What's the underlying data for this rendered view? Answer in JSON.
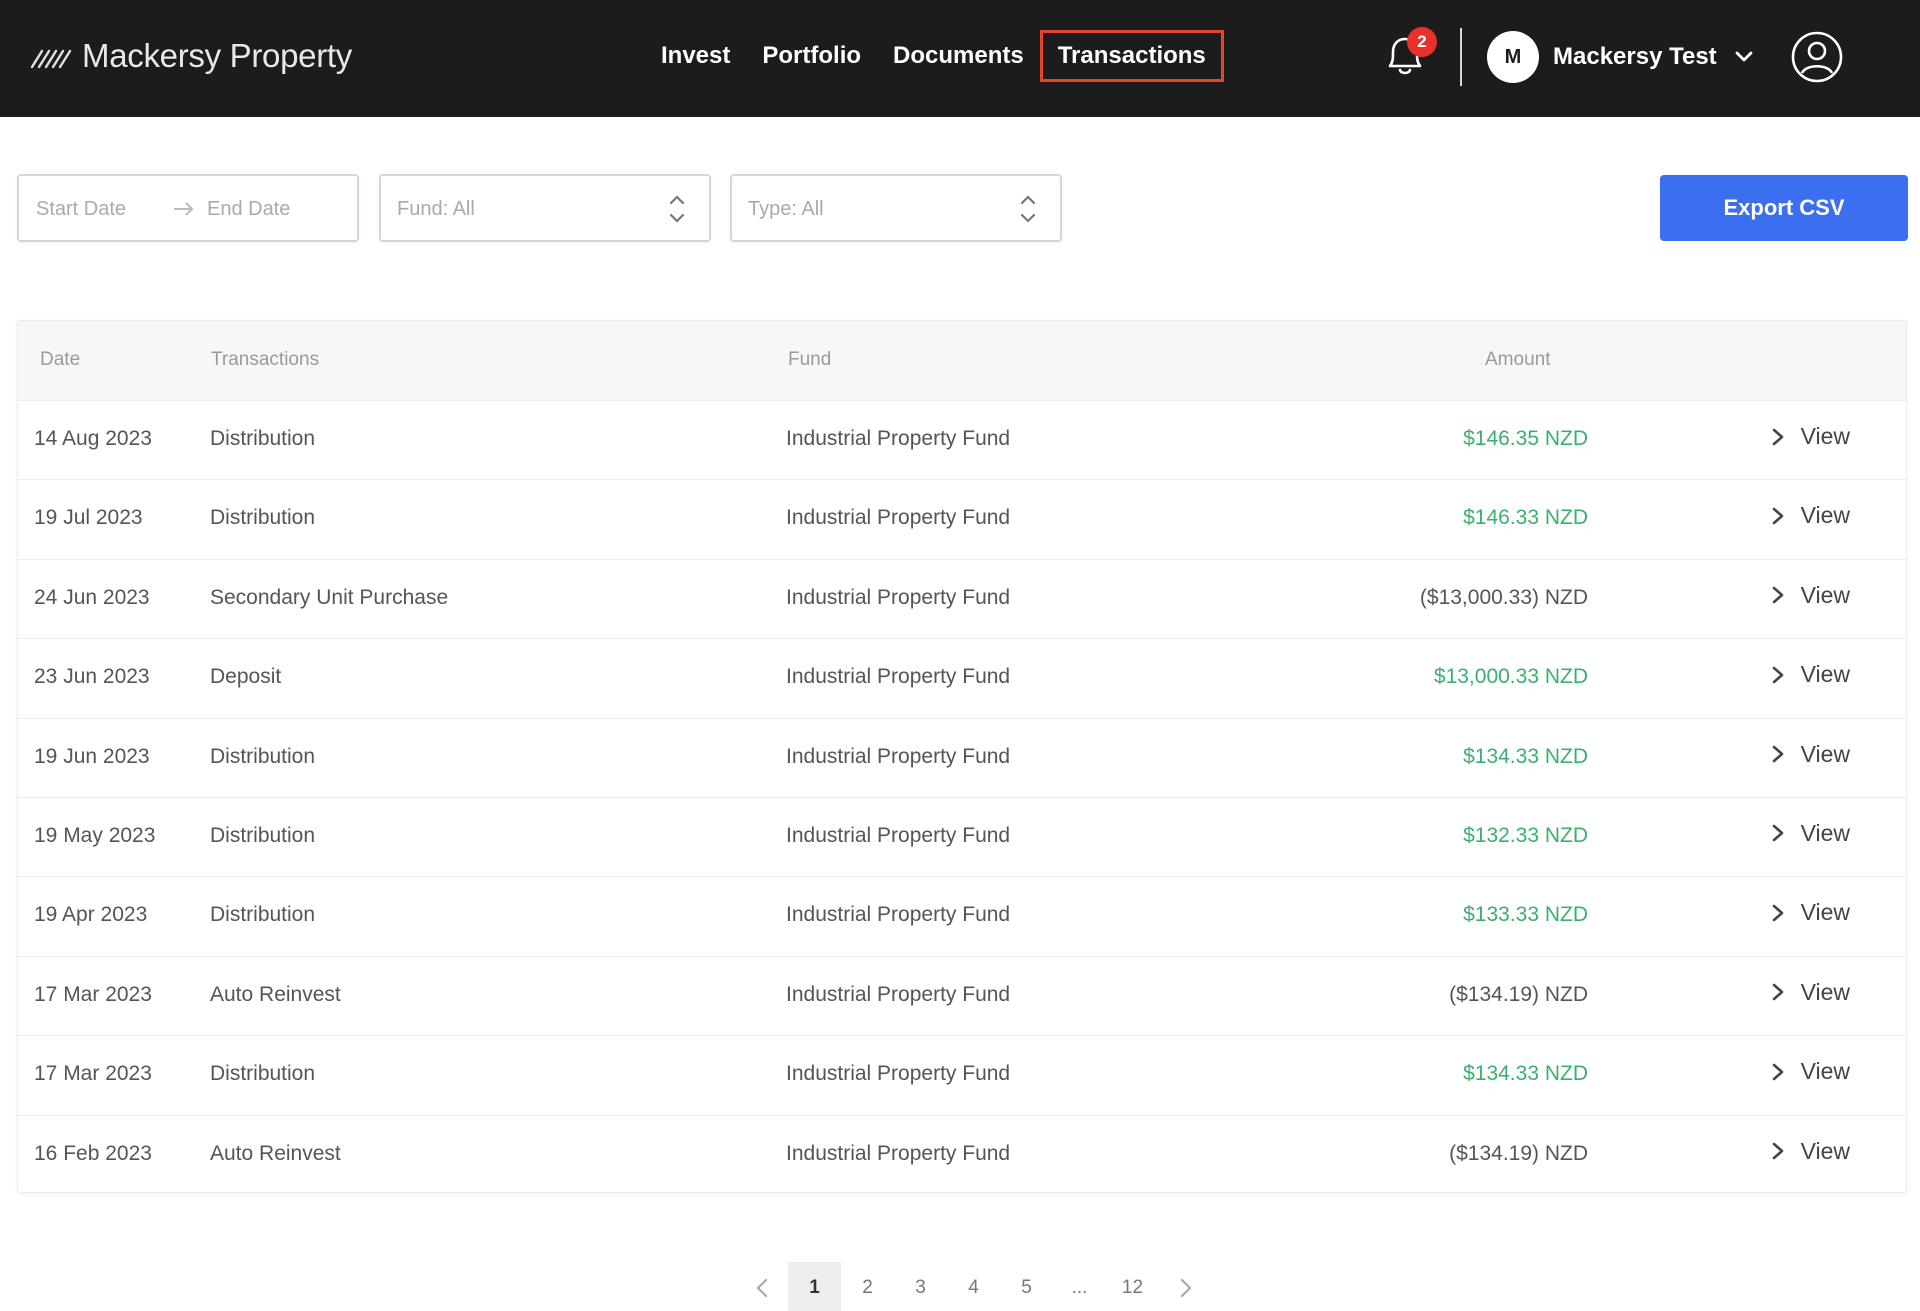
{
  "header": {
    "brand": "Mackersy Property",
    "nav": [
      {
        "label": "Invest",
        "active": false
      },
      {
        "label": "Portfolio",
        "active": false
      },
      {
        "label": "Documents",
        "active": false
      },
      {
        "label": "Transactions",
        "active": true
      }
    ],
    "notifications_count": "2",
    "user": {
      "initial": "M",
      "name": "Mackersy Test"
    },
    "icons": {
      "notifications": "bell-icon",
      "dropdown": "chevron-down-icon",
      "account": "user-circle-icon"
    }
  },
  "filters": {
    "start_date_placeholder": "Start Date",
    "end_date_placeholder": "End Date",
    "fund": "Fund: All",
    "type": "Type: All",
    "export_label": "Export CSV"
  },
  "table": {
    "headers": {
      "date": "Date",
      "transactions": "Transactions",
      "fund": "Fund",
      "amount": "Amount"
    },
    "rows": [
      {
        "date": "14 Aug 2023",
        "transaction": "Distribution",
        "fund": "Industrial Property Fund",
        "amount": "$146.35 NZD",
        "positive": true,
        "action": "View"
      },
      {
        "date": "19 Jul 2023",
        "transaction": "Distribution",
        "fund": "Industrial Property Fund",
        "amount": "$146.33 NZD",
        "positive": true,
        "action": "View"
      },
      {
        "date": "24 Jun 2023",
        "transaction": "Secondary Unit Purchase",
        "fund": "Industrial Property Fund",
        "amount": "($13,000.33) NZD",
        "positive": false,
        "action": "View"
      },
      {
        "date": "23 Jun 2023",
        "transaction": "Deposit",
        "fund": "Industrial Property Fund",
        "amount": "$13,000.33 NZD",
        "positive": true,
        "action": "View"
      },
      {
        "date": "19 Jun 2023",
        "transaction": "Distribution",
        "fund": "Industrial Property Fund",
        "amount": "$134.33 NZD",
        "positive": true,
        "action": "View"
      },
      {
        "date": "19 May 2023",
        "transaction": "Distribution",
        "fund": "Industrial Property Fund",
        "amount": "$132.33 NZD",
        "positive": true,
        "action": "View"
      },
      {
        "date": "19 Apr 2023",
        "transaction": "Distribution",
        "fund": "Industrial Property Fund",
        "amount": "$133.33 NZD",
        "positive": true,
        "action": "View"
      },
      {
        "date": "17 Mar 2023",
        "transaction": "Auto Reinvest",
        "fund": "Industrial Property Fund",
        "amount": "($134.19) NZD",
        "positive": false,
        "action": "View"
      },
      {
        "date": "17 Mar 2023",
        "transaction": "Distribution",
        "fund": "Industrial Property Fund",
        "amount": "$134.33 NZD",
        "positive": true,
        "action": "View"
      },
      {
        "date": "16 Feb 2023",
        "transaction": "Auto Reinvest",
        "fund": "Industrial Property Fund",
        "amount": "($134.19) NZD",
        "positive": false,
        "action": "View"
      }
    ]
  },
  "pagination": {
    "pages": [
      "1",
      "2",
      "3",
      "4",
      "5",
      "...",
      "12"
    ],
    "current": "1"
  },
  "colors": {
    "header_bg": "#1c1c1c",
    "active_nav_border": "#e8412f",
    "badge": "#e8312a",
    "export_button": "#3b6ff0",
    "positive_amount": "#3bb06e"
  }
}
